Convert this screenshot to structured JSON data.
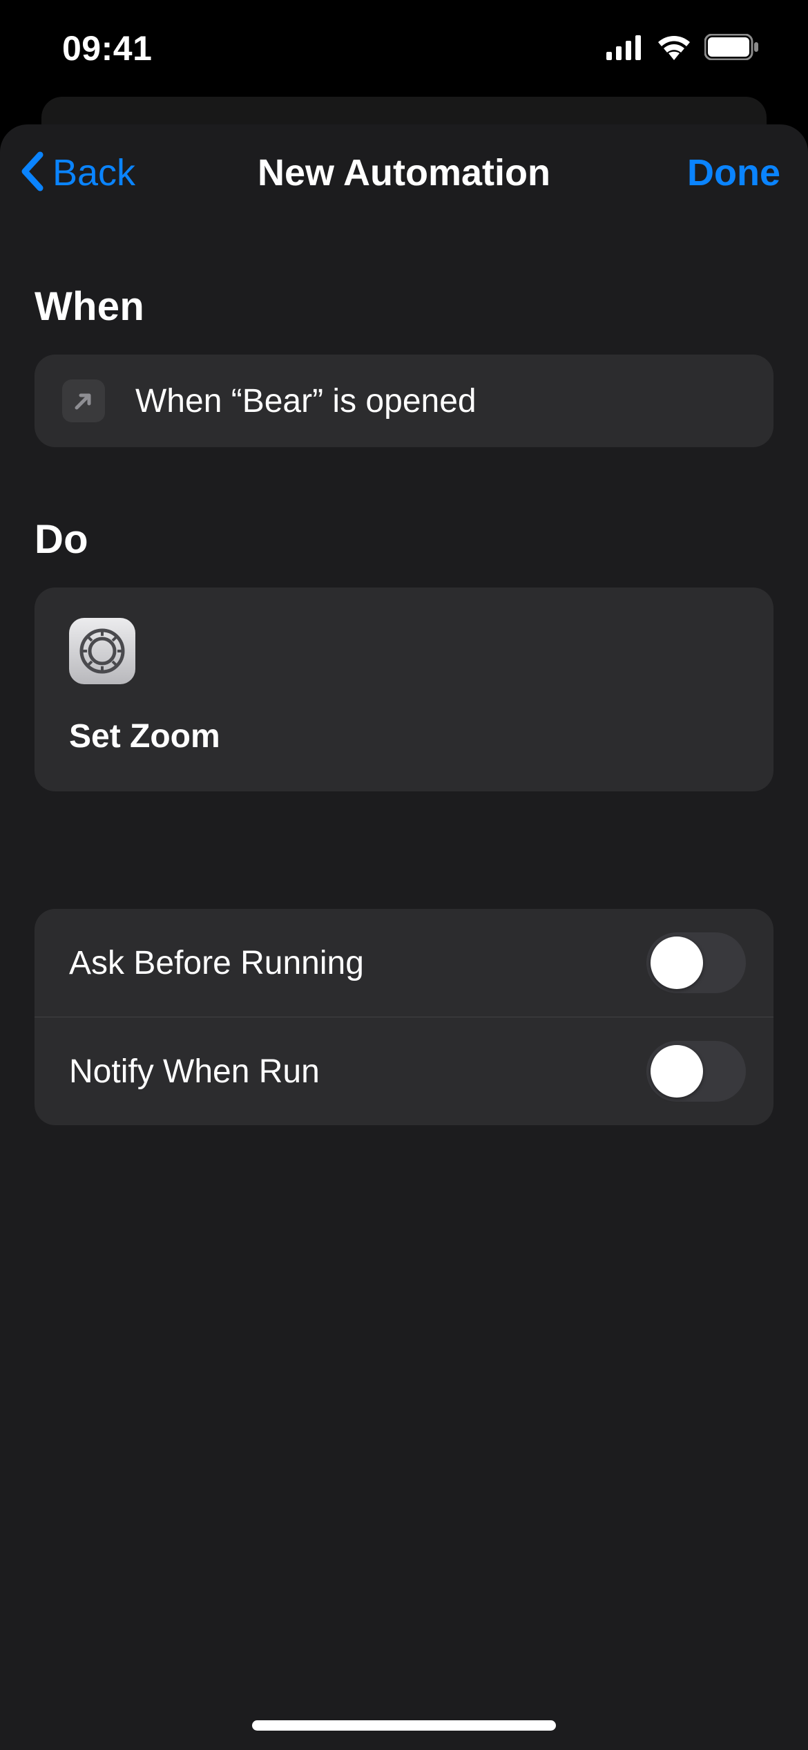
{
  "status": {
    "time": "09:41"
  },
  "navbar": {
    "back_label": "Back",
    "title": "New Automation",
    "done_label": "Done"
  },
  "sections": {
    "when": {
      "title": "When",
      "trigger_text": "When “Bear” is opened",
      "icon_name": "app-open-arrow-icon"
    },
    "do": {
      "title": "Do",
      "action_label": "Set Zoom",
      "action_icon_name": "settings-app-icon"
    }
  },
  "options": [
    {
      "label": "Ask Before Running",
      "value": false
    },
    {
      "label": "Notify When Run",
      "value": false
    }
  ],
  "colors": {
    "accent": "#0a84ff",
    "sheet_bg": "#1c1c1e",
    "card_bg": "#2c2c2e"
  }
}
